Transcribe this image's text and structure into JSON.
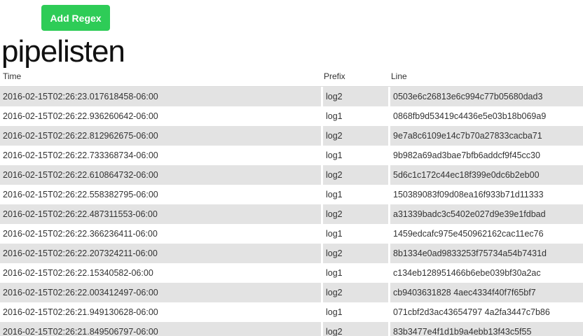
{
  "toolbar": {
    "add_regex_label": "Add Regex"
  },
  "page": {
    "title": "pipelisten"
  },
  "table": {
    "headers": {
      "time": "Time",
      "prefix": "Prefix",
      "line": "Line"
    },
    "rows": [
      {
        "time": "2016-02-15T02:26:23.017618458-06:00",
        "prefix": "log2",
        "line": "0503e6c26813e6c994c77b05680dad3"
      },
      {
        "time": "2016-02-15T02:26:22.936260642-06:00",
        "prefix": "log1",
        "line": "0868fb9d53419c4436e5e03b18b069a9"
      },
      {
        "time": "2016-02-15T02:26:22.812962675-06:00",
        "prefix": "log2",
        "line": "9e7a8c6109e14c7b70a27833cacba71"
      },
      {
        "time": "2016-02-15T02:26:22.733368734-06:00",
        "prefix": "log1",
        "line": "9b982a69ad3bae7bfb6addcf9f45cc30"
      },
      {
        "time": "2016-02-15T02:26:22.610864732-06:00",
        "prefix": "log2",
        "line": "5d6c1c172c44ec18f399e0dc6b2eb00"
      },
      {
        "time": "2016-02-15T02:26:22.558382795-06:00",
        "prefix": "log1",
        "line": "150389083f09d08ea16f933b71d11333"
      },
      {
        "time": "2016-02-15T02:26:22.487311553-06:00",
        "prefix": "log2",
        "line": "a31339badc3c5402e027d9e39e1fdbad"
      },
      {
        "time": "2016-02-15T02:26:22.366236411-06:00",
        "prefix": "log1",
        "line": "1459edcafc975e450962162cac11ec76"
      },
      {
        "time": "2016-02-15T02:26:22.207324211-06:00",
        "prefix": "log2",
        "line": "8b1334e0ad9833253f75734a54b7431d"
      },
      {
        "time": "2016-02-15T02:26:22.15340582-06:00",
        "prefix": "log1",
        "line": "c134eb128951466b6ebe039bf30a2ac"
      },
      {
        "time": "2016-02-15T02:26:22.003412497-06:00",
        "prefix": "log2",
        "line": "cb9403631828 4aec4334f40f7f65bf7"
      },
      {
        "time": "2016-02-15T02:26:21.949130628-06:00",
        "prefix": "log1",
        "line": "071cbf2d3ac43654797 4a2fa3447c7b86"
      },
      {
        "time": "2016-02-15T02:26:21.849506797-06:00",
        "prefix": "log2",
        "line": "83b3477e4f1d1b9a4ebb13f43c5f55"
      }
    ]
  },
  "colors": {
    "button_bg": "#2ecc57",
    "button_text": "#ffffff",
    "stripe": "#e3e3e3"
  }
}
